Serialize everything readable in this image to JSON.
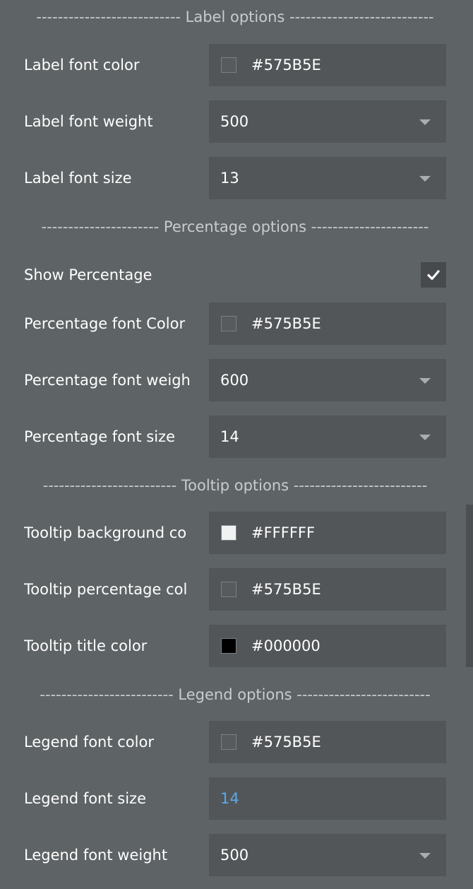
{
  "sections": {
    "label": "--------------------------- Label options ---------------------------",
    "percentage": "---------------------- Percentage options ----------------------",
    "tooltip": "------------------------- Tooltip options -------------------------",
    "legend": "------------------------- Legend options -------------------------"
  },
  "label_options": {
    "font_color": {
      "label": "Label font color",
      "value": "#575B5E",
      "swatch": "#575B5E"
    },
    "font_weight": {
      "label": "Label font weight",
      "value": "500"
    },
    "font_size": {
      "label": "Label font size",
      "value": "13"
    }
  },
  "percentage_options": {
    "show": {
      "label": "Show Percentage",
      "checked": true
    },
    "font_color": {
      "label": "Percentage font Color",
      "value": "#575B5E",
      "swatch": "#575B5E"
    },
    "font_weight": {
      "label": "Percentage font weigh",
      "value": "600"
    },
    "font_size": {
      "label": "Percentage font size",
      "value": "14"
    }
  },
  "tooltip_options": {
    "background_color": {
      "label": "Tooltip background co",
      "value": "#FFFFFF",
      "swatch": "#F1F2F2"
    },
    "percentage_color": {
      "label": "Tooltip percentage col",
      "value": "#575B5E",
      "swatch": "#575B5E"
    },
    "title_color": {
      "label": "Tooltip title color",
      "value": "#000000",
      "swatch": "#000000"
    }
  },
  "legend_options": {
    "font_color": {
      "label": "Legend font color",
      "value": "#575B5E",
      "swatch": "#575B5E"
    },
    "font_size": {
      "label": "Legend font size",
      "value": "14"
    },
    "font_weight": {
      "label": "Legend font weight",
      "value": "500"
    }
  },
  "colors": {
    "panel_background": "#5E6365",
    "field_background": "#525658",
    "link_value": "#5AA9EA"
  }
}
